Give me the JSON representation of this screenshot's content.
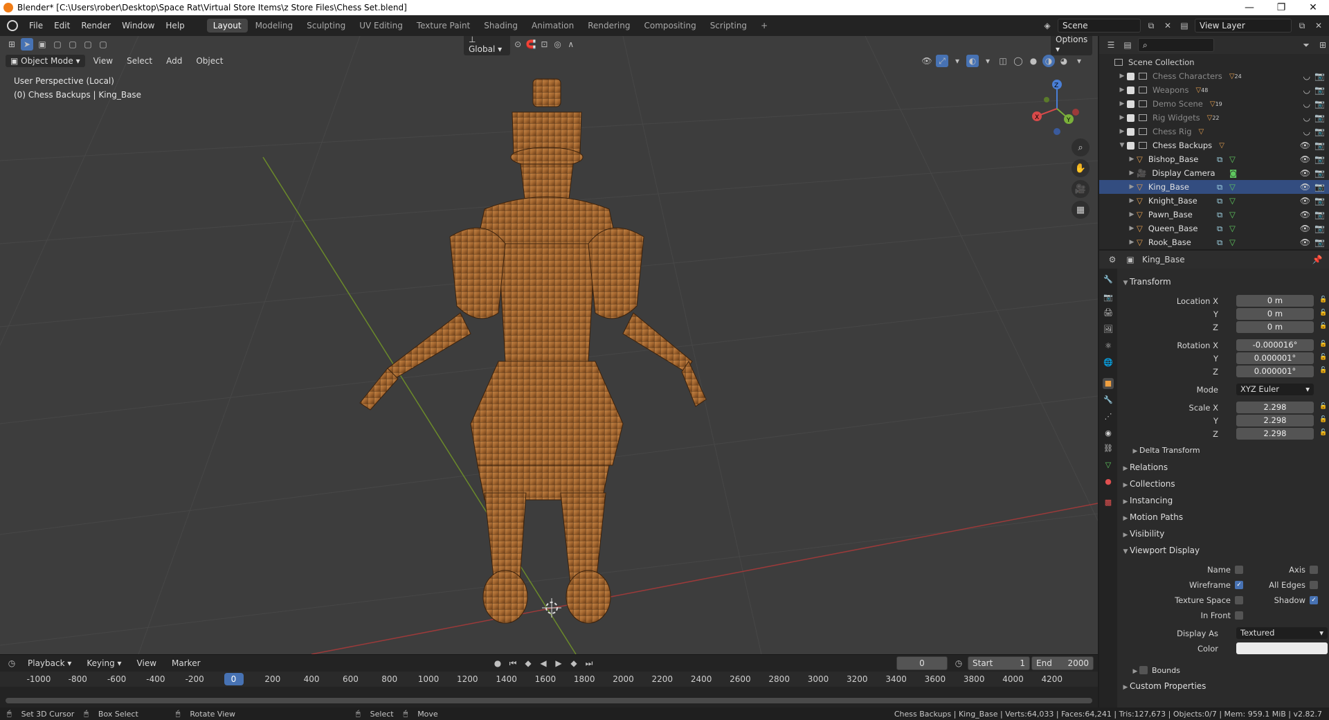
{
  "titlebar": {
    "title": "Blender* [C:\\Users\\rober\\Desktop\\Space Rat\\Virtual Store Items\\z Store Files\\Chess Set.blend]"
  },
  "menus": [
    "File",
    "Edit",
    "Render",
    "Window",
    "Help"
  ],
  "workspaces": [
    "Layout",
    "Modeling",
    "Sculpting",
    "UV Editing",
    "Texture Paint",
    "Shading",
    "Animation",
    "Rendering",
    "Compositing",
    "Scripting"
  ],
  "scene": {
    "name": "Scene",
    "view_layer": "View Layer"
  },
  "viewport": {
    "mode": "Object Mode",
    "menus": [
      "View",
      "Select",
      "Add",
      "Object"
    ],
    "orientation": "Global",
    "options": "Options",
    "perspective": "User Perspective (Local)",
    "context": "(0) Chess Backups | King_Base"
  },
  "timeline": {
    "menus": [
      "Playback",
      "Keying",
      "View",
      "Marker"
    ],
    "current_frame": "0",
    "start_label": "Start",
    "start": "1",
    "end_label": "End",
    "end": "2000",
    "ticks": [
      "-1000",
      "-800",
      "-600",
      "-400",
      "-200",
      "0",
      "200",
      "400",
      "600",
      "800",
      "1000",
      "1200",
      "1400",
      "1600",
      "1800",
      "2000",
      "2200",
      "2400",
      "2600",
      "2800",
      "3000",
      "3200",
      "3400",
      "3600",
      "3800",
      "4000",
      "4200"
    ]
  },
  "statusbar": {
    "items": [
      "Set 3D Cursor",
      "Box Select",
      "Rotate View",
      "Select",
      "Move"
    ],
    "info": "Chess Backups | King_Base | Verts:64,033 | Faces:64,241 | Tris:127,673 | Objects:0/7 | Mem: 959.1 MiB | v2.82.7"
  },
  "outliner": {
    "root": "Scene Collection",
    "collections": [
      {
        "name": "Chess Characters",
        "count": "24"
      },
      {
        "name": "Weapons",
        "count": "48"
      },
      {
        "name": "Demo Scene",
        "count": "19"
      },
      {
        "name": "Rig Widgets",
        "count": "22"
      },
      {
        "name": "Chess Rig",
        "count": ""
      },
      {
        "name": "Chess Backups",
        "count": ""
      }
    ],
    "objects": [
      "Bishop_Base",
      "Display Camera",
      "King_Base",
      "Knight_Base",
      "Pawn_Base",
      "Queen_Base",
      "Rook_Base"
    ]
  },
  "properties": {
    "object_name": "King_Base",
    "transform": "Transform",
    "location_label": "Location X",
    "loc_x": "0 m",
    "loc_y": "0 m",
    "loc_z": "0 m",
    "rotation_label": "Rotation X",
    "rot_x": "-0.000016°",
    "rot_y": "0.000001°",
    "rot_z": "0.000001°",
    "mode_label": "Mode",
    "mode": "XYZ Euler",
    "scale_label": "Scale X",
    "scale_x": "2.298",
    "scale_y": "2.298",
    "scale_z": "2.298",
    "y": "Y",
    "z": "Z",
    "delta": "Delta Transform",
    "panels": [
      "Relations",
      "Collections",
      "Instancing",
      "Motion Paths",
      "Visibility"
    ],
    "viewport_display": "Viewport Display",
    "name_label": "Name",
    "axis_label": "Axis",
    "wireframe_label": "Wireframe",
    "all_edges_label": "All Edges",
    "texture_space_label": "Texture Space",
    "shadow_label": "Shadow",
    "in_front_label": "In Front",
    "display_as_label": "Display As",
    "display_as": "Textured",
    "color_label": "Color",
    "bounds": "Bounds",
    "custom": "Custom Properties"
  }
}
